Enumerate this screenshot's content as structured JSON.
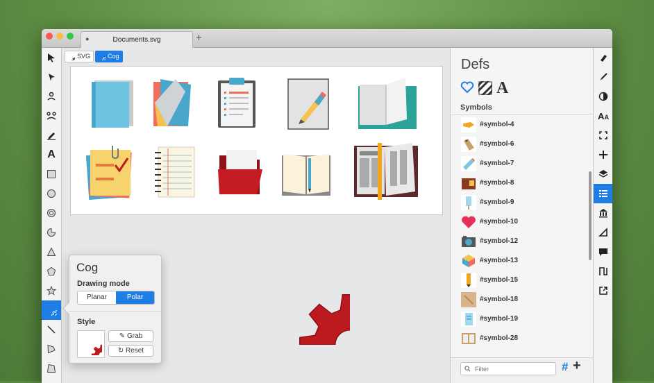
{
  "window": {
    "tab_title": "Documents.svg",
    "new_tab": "+"
  },
  "traffic_lights": {
    "close": "#fc5753",
    "minimize": "#fdbc40",
    "zoom": "#33c748"
  },
  "breadcrumb": {
    "items": [
      {
        "label": "SVG",
        "icon": "gear-outline-icon"
      },
      {
        "label": "Cog",
        "icon": "cog-icon",
        "selected": true
      }
    ]
  },
  "toolbar": {
    "tools": [
      "select-arrow-icon",
      "node-arrow-icon",
      "person-icon",
      "people-icon",
      "pen-icon",
      "text-icon",
      "rectangle-icon",
      "circle-icon",
      "ring-icon",
      "crescent-icon",
      "triangle-icon",
      "pentagon-icon",
      "star-icon",
      "cog-tool-icon",
      "line-icon",
      "flag-icon",
      "parallelogram-icon"
    ],
    "active_tool": "cog-tool-icon"
  },
  "cog_panel": {
    "title": "Cog",
    "drawing_mode_label": "Drawing mode",
    "modes": [
      "Planar",
      "Polar"
    ],
    "selected_mode": "Polar",
    "style_label": "Style",
    "grab_label": "Grab",
    "reset_label": "Reset"
  },
  "defs": {
    "title": "Defs",
    "icons": [
      "heart-icon",
      "hatch-pattern-icon",
      "font-a-icon"
    ],
    "symbols_header": "Symbols",
    "symbols": [
      "#symbol-4",
      "#symbol-6",
      "#symbol-7",
      "#symbol-8",
      "#symbol-9",
      "#symbol-10",
      "#symbol-12",
      "#symbol-13",
      "#symbol-15",
      "#symbol-18",
      "#symbol-19",
      "#symbol-28"
    ],
    "filter_placeholder": "Filter",
    "hash_label": "#",
    "add_label": "+"
  },
  "right_toolbar": {
    "tools": [
      "paint-brush-icon",
      "brush-icon",
      "contrast-icon",
      "font-size-icon",
      "fullscreen-icon",
      "move-icon",
      "layers-icon",
      "list-icon",
      "bank-icon",
      "angle-icon",
      "comment-icon",
      "path-icon",
      "export-icon"
    ],
    "active_tool": "list-icon"
  },
  "colors": {
    "accent": "#1f7de6",
    "cog_red": "#bb1a1f"
  }
}
